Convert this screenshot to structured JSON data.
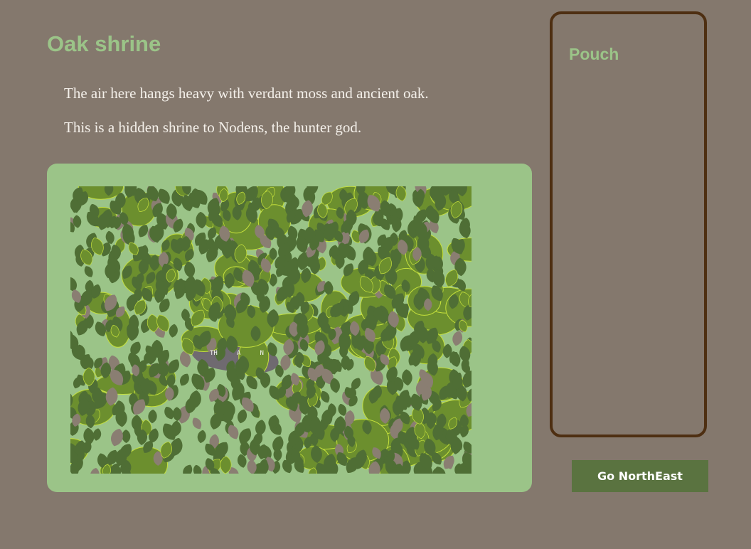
{
  "location": {
    "title": "Oak shrine",
    "description": [
      "The air here hangs heavy with verdant moss and ancient oak.",
      "This is a hidden shrine to Nodens, the hunter god."
    ]
  },
  "scene": {
    "hidden_text": "TH     A     N",
    "colors": {
      "panel": "#9bc488",
      "leaf_dark": "#4f6e35",
      "leaf_mid": "#6c8f2e",
      "leaf_edge": "#c5e03c",
      "leaf_dead": "#8a7e72",
      "shrine_stone": "#6f6a70"
    }
  },
  "inventory": {
    "title": "Pouch",
    "items": []
  },
  "actions": [
    {
      "label": "Go NorthEast"
    }
  ],
  "colors": {
    "background": "#84786d",
    "accent": "#9bc488",
    "text": "#f4f0ea",
    "border": "#4e2f12",
    "button": "#5a7340"
  }
}
